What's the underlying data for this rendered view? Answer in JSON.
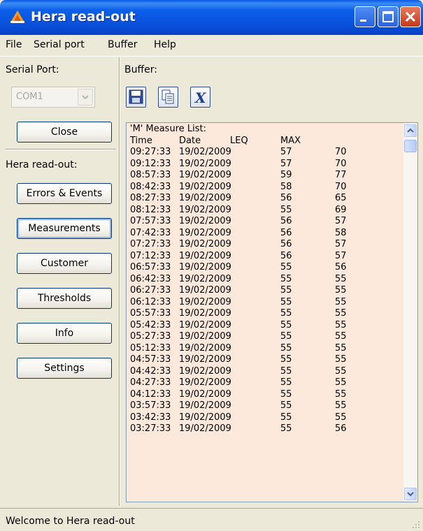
{
  "window": {
    "title": "Hera read-out"
  },
  "menu": [
    "File",
    "Serial port",
    "Buffer",
    "Help"
  ],
  "left": {
    "serial_port_label": "Serial Port:",
    "com_value": "COM1",
    "close_label": "Close",
    "hera_label": "Hera read-out:",
    "buttons": [
      "Errors & Events",
      "Measurements",
      "Customer",
      "Thresholds",
      "Info",
      "Settings"
    ]
  },
  "buffer": {
    "label": "Buffer:",
    "list_title": "'M' Measure List:",
    "headers": [
      "Time",
      "Date",
      "LEQ",
      "MAX"
    ],
    "rows": [
      [
        "09:27:33",
        "19/02/2009",
        "57",
        "70"
      ],
      [
        "09:12:33",
        "19/02/2009",
        "57",
        "70"
      ],
      [
        "08:57:33",
        "19/02/2009",
        "59",
        "77"
      ],
      [
        "08:42:33",
        "19/02/2009",
        "58",
        "70"
      ],
      [
        "08:27:33",
        "19/02/2009",
        "56",
        "65"
      ],
      [
        "08:12:33",
        "19/02/2009",
        "55",
        "69"
      ],
      [
        "07:57:33",
        "19/02/2009",
        "56",
        "57"
      ],
      [
        "07:42:33",
        "19/02/2009",
        "56",
        "58"
      ],
      [
        "07:27:33",
        "19/02/2009",
        "56",
        "57"
      ],
      [
        "07:12:33",
        "19/02/2009",
        "56",
        "57"
      ],
      [
        "06:57:33",
        "19/02/2009",
        "55",
        "56"
      ],
      [
        "06:42:33",
        "19/02/2009",
        "55",
        "55"
      ],
      [
        "06:27:33",
        "19/02/2009",
        "55",
        "55"
      ],
      [
        "06:12:33",
        "19/02/2009",
        "55",
        "55"
      ],
      [
        "05:57:33",
        "19/02/2009",
        "55",
        "55"
      ],
      [
        "05:42:33",
        "19/02/2009",
        "55",
        "55"
      ],
      [
        "05:27:33",
        "19/02/2009",
        "55",
        "55"
      ],
      [
        "05:12:33",
        "19/02/2009",
        "55",
        "55"
      ],
      [
        "04:57:33",
        "19/02/2009",
        "55",
        "55"
      ],
      [
        "04:42:33",
        "19/02/2009",
        "55",
        "55"
      ],
      [
        "04:27:33",
        "19/02/2009",
        "55",
        "55"
      ],
      [
        "04:12:33",
        "19/02/2009",
        "55",
        "55"
      ],
      [
        "03:57:33",
        "19/02/2009",
        "55",
        "55"
      ],
      [
        "03:42:33",
        "19/02/2009",
        "55",
        "55"
      ],
      [
        "03:27:33",
        "19/02/2009",
        "55",
        "56"
      ]
    ]
  },
  "status": {
    "text": "Welcome to Hera read-out"
  },
  "colors": {
    "titlebar": "#0b5ee8",
    "buffer_bg": "#fce9dc",
    "app_icon": "#f39c1e"
  },
  "icons": [
    "app-icon",
    "minimize-icon",
    "maximize-icon",
    "close-icon",
    "save-icon",
    "copy-icon",
    "clear-icon",
    "scroll-up-icon",
    "scroll-down-icon",
    "resize-grip-icon"
  ]
}
